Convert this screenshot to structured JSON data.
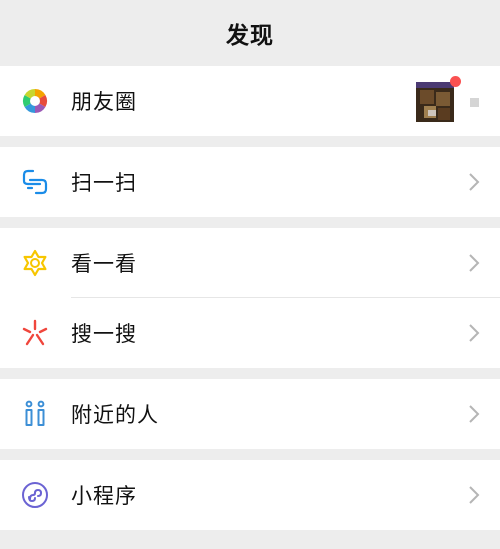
{
  "header": {
    "title": "发现"
  },
  "menu": {
    "moments": {
      "label": "朋友圈",
      "icon": "moments-icon"
    },
    "scan": {
      "label": "扫一扫",
      "icon": "scan-icon"
    },
    "top_stories": {
      "label": "看一看",
      "icon": "top-stories-icon"
    },
    "search": {
      "label": "搜一搜",
      "icon": "search-icon"
    },
    "nearby": {
      "label": "附近的人",
      "icon": "people-nearby-icon"
    },
    "mini_programs": {
      "label": "小程序",
      "icon": "mini-program-icon"
    }
  },
  "colors": {
    "background": "#ededed",
    "surface": "#ffffff",
    "badge": "#fa5151",
    "scan_blue": "#1a8ce8",
    "top_stories_yellow": "#f7c600",
    "search_red": "#f0463c",
    "nearby_blue": "#3c8fd6",
    "mini_program_purple": "#6b63d3"
  }
}
